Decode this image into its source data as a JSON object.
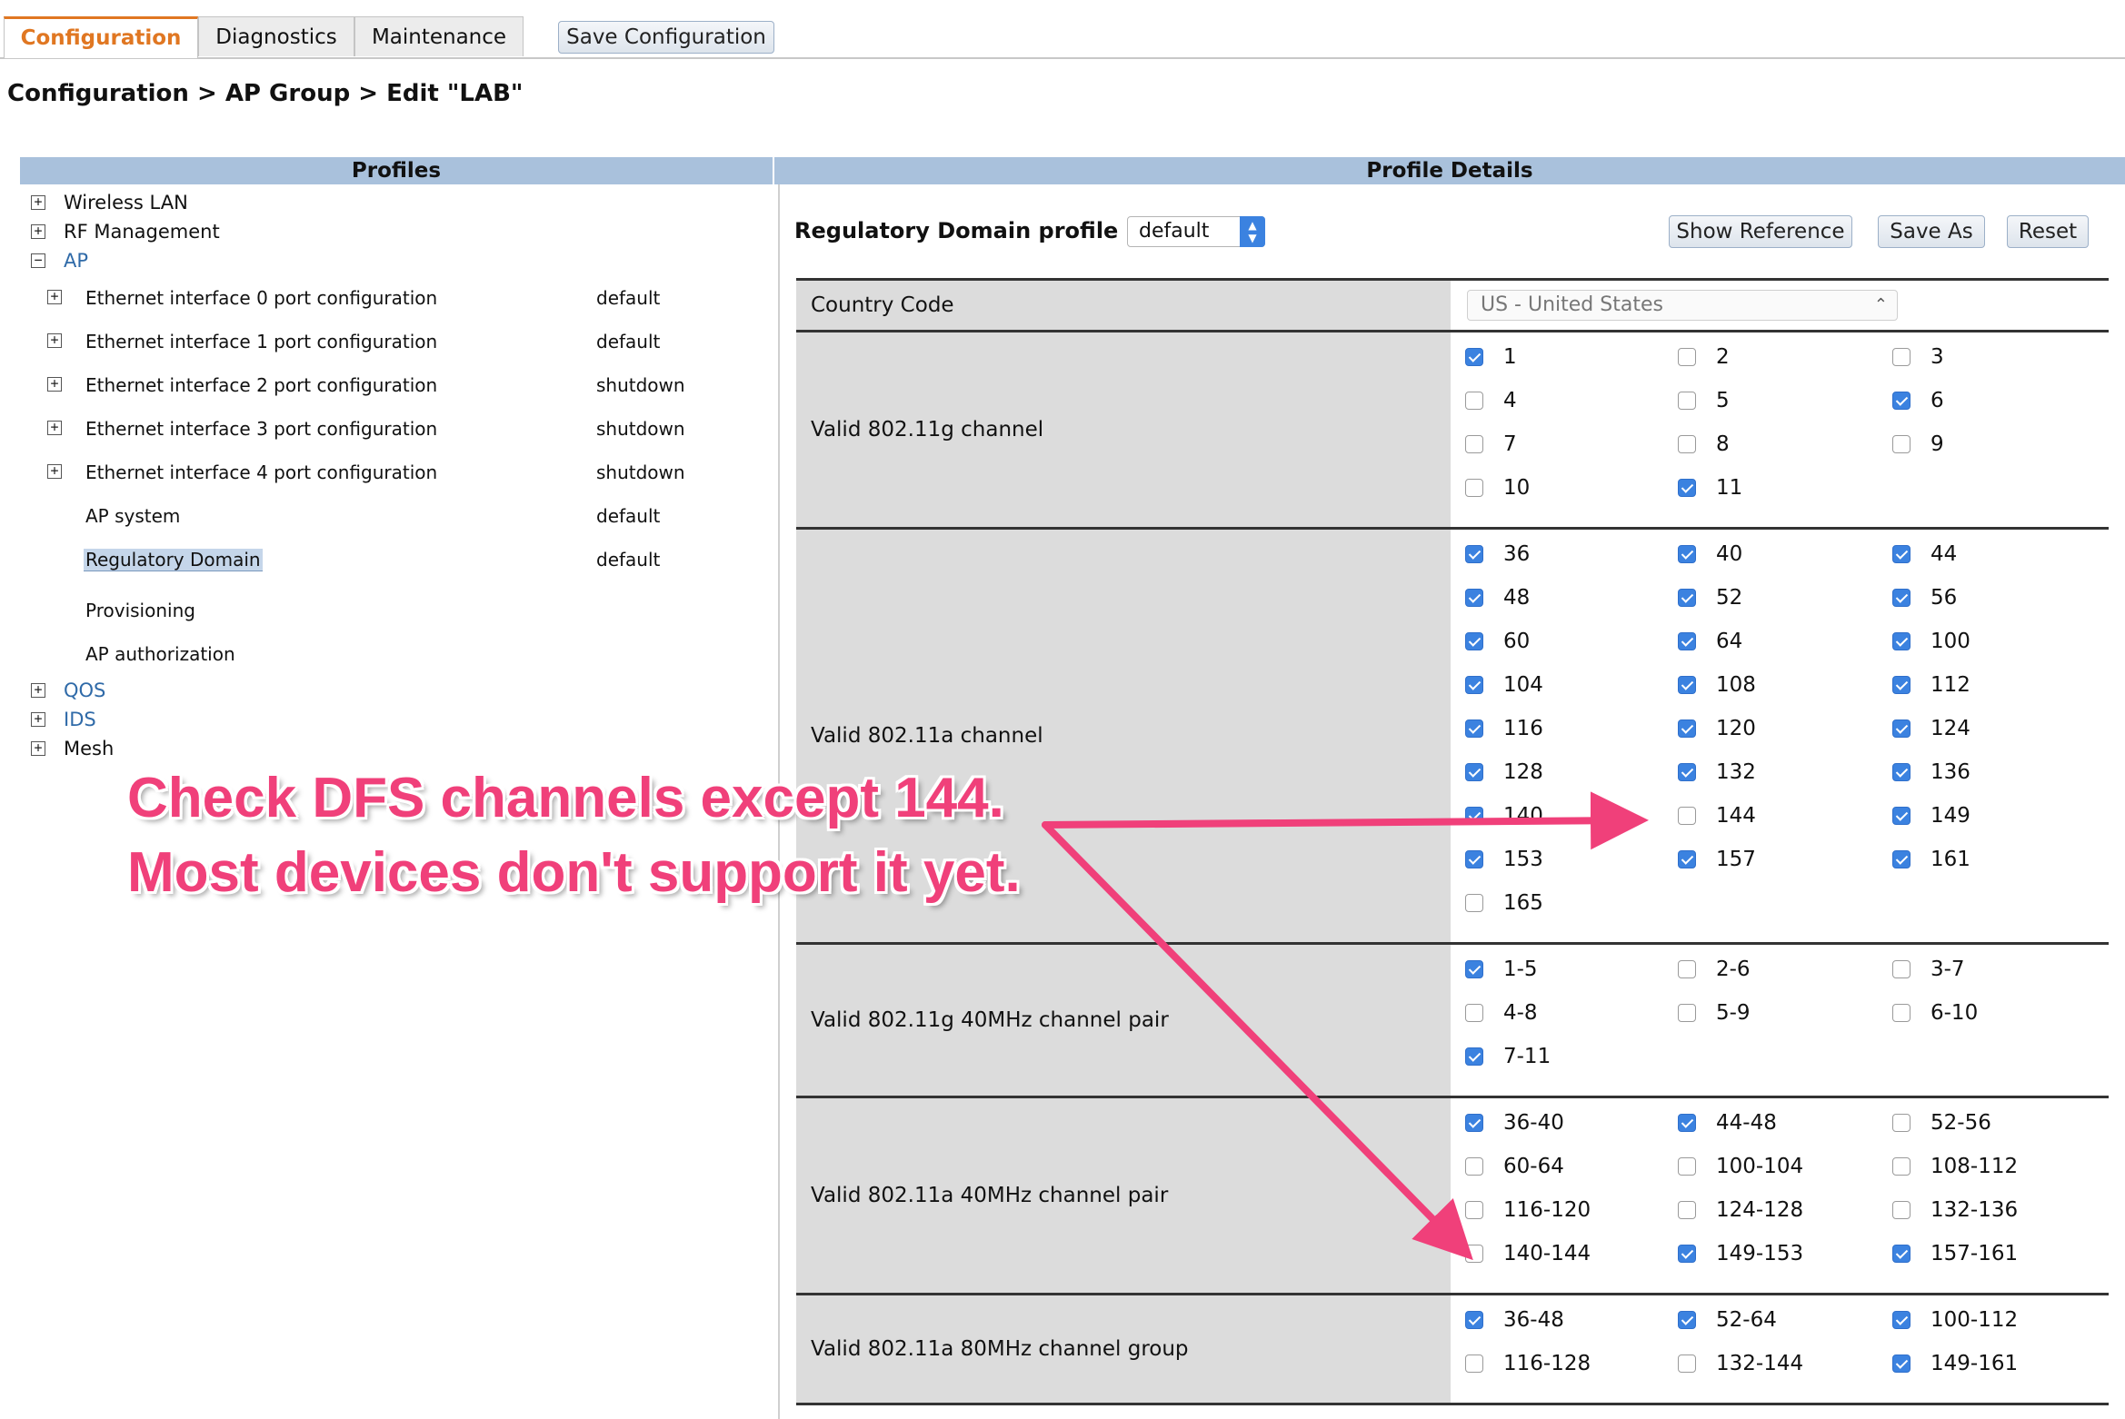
{
  "tabs": [
    {
      "label": "Configuration",
      "active": true
    },
    {
      "label": "Diagnostics",
      "active": false
    },
    {
      "label": "Maintenance",
      "active": false
    }
  ],
  "save_configuration_label": "Save Configuration",
  "breadcrumb": "Configuration > AP Group > Edit \"LAB\"",
  "profiles": {
    "header": "Profiles",
    "wireless_lan": "Wireless LAN",
    "rf_management": "RF Management",
    "ap": "AP",
    "ap_items": [
      {
        "label": "Ethernet interface 0 port configuration",
        "value": "default"
      },
      {
        "label": "Ethernet interface 1 port configuration",
        "value": "default"
      },
      {
        "label": "Ethernet interface 2 port configuration",
        "value": "shutdown"
      },
      {
        "label": "Ethernet interface 3 port configuration",
        "value": "shutdown"
      },
      {
        "label": "Ethernet interface 4 port configuration",
        "value": "shutdown"
      },
      {
        "label": "AP system",
        "value": "default"
      },
      {
        "label": "Regulatory Domain",
        "value": "default"
      },
      {
        "label": "Provisioning",
        "value": ""
      },
      {
        "label": "AP authorization",
        "value": ""
      }
    ],
    "qos": "QOS",
    "ids": "IDS",
    "mesh": "Mesh"
  },
  "details": {
    "header": "Profile Details",
    "profile_label": "Regulatory Domain profile >",
    "profile_value": "default",
    "show_reference": "Show Reference",
    "save_as": "Save As",
    "reset": "Reset",
    "country_label": "Country Code",
    "country_value": "US - United States",
    "groups": [
      {
        "label": "Valid 802.11g channel",
        "items": [
          {
            "t": "1",
            "c": true
          },
          {
            "t": "2",
            "c": false
          },
          {
            "t": "3",
            "c": false
          },
          {
            "t": "4",
            "c": false
          },
          {
            "t": "5",
            "c": false
          },
          {
            "t": "6",
            "c": true
          },
          {
            "t": "7",
            "c": false
          },
          {
            "t": "8",
            "c": false
          },
          {
            "t": "9",
            "c": false
          },
          {
            "t": "10",
            "c": false
          },
          {
            "t": "11",
            "c": true
          }
        ]
      },
      {
        "label": "Valid 802.11a channel",
        "items": [
          {
            "t": "36",
            "c": true
          },
          {
            "t": "40",
            "c": true
          },
          {
            "t": "44",
            "c": true
          },
          {
            "t": "48",
            "c": true
          },
          {
            "t": "52",
            "c": true
          },
          {
            "t": "56",
            "c": true
          },
          {
            "t": "60",
            "c": true
          },
          {
            "t": "64",
            "c": true
          },
          {
            "t": "100",
            "c": true
          },
          {
            "t": "104",
            "c": true
          },
          {
            "t": "108",
            "c": true
          },
          {
            "t": "112",
            "c": true
          },
          {
            "t": "116",
            "c": true
          },
          {
            "t": "120",
            "c": true
          },
          {
            "t": "124",
            "c": true
          },
          {
            "t": "128",
            "c": true
          },
          {
            "t": "132",
            "c": true
          },
          {
            "t": "136",
            "c": true
          },
          {
            "t": "140",
            "c": true
          },
          {
            "t": "144",
            "c": false
          },
          {
            "t": "149",
            "c": true
          },
          {
            "t": "153",
            "c": true
          },
          {
            "t": "157",
            "c": true
          },
          {
            "t": "161",
            "c": true
          },
          {
            "t": "165",
            "c": false
          }
        ]
      },
      {
        "label": "Valid 802.11g 40MHz channel pair",
        "items": [
          {
            "t": "1-5",
            "c": true
          },
          {
            "t": "2-6",
            "c": false
          },
          {
            "t": "3-7",
            "c": false
          },
          {
            "t": "4-8",
            "c": false
          },
          {
            "t": "5-9",
            "c": false
          },
          {
            "t": "6-10",
            "c": false
          },
          {
            "t": "7-11",
            "c": true
          }
        ]
      },
      {
        "label": "Valid 802.11a 40MHz channel pair",
        "items": [
          {
            "t": "36-40",
            "c": true
          },
          {
            "t": "44-48",
            "c": true
          },
          {
            "t": "52-56",
            "c": false
          },
          {
            "t": "60-64",
            "c": false
          },
          {
            "t": "100-104",
            "c": false
          },
          {
            "t": "108-112",
            "c": false
          },
          {
            "t": "116-120",
            "c": false
          },
          {
            "t": "124-128",
            "c": false
          },
          {
            "t": "132-136",
            "c": false
          },
          {
            "t": "140-144",
            "c": false
          },
          {
            "t": "149-153",
            "c": true
          },
          {
            "t": "157-161",
            "c": true
          }
        ]
      },
      {
        "label": "Valid 802.11a 80MHz channel group",
        "items": [
          {
            "t": "36-48",
            "c": true
          },
          {
            "t": "52-64",
            "c": true
          },
          {
            "t": "100-112",
            "c": true
          },
          {
            "t": "116-128",
            "c": false
          },
          {
            "t": "132-144",
            "c": false
          },
          {
            "t": "149-161",
            "c": true
          }
        ]
      }
    ]
  },
  "annotation": {
    "line1": "Check DFS channels except 144.",
    "line2": "Most devices don't support it yet."
  },
  "colors": {
    "accent_tab": "#e07722",
    "header_blue": "#a9c1dc",
    "checkbox_blue": "#3b82e0",
    "annotation_pink": "#f0407a"
  }
}
